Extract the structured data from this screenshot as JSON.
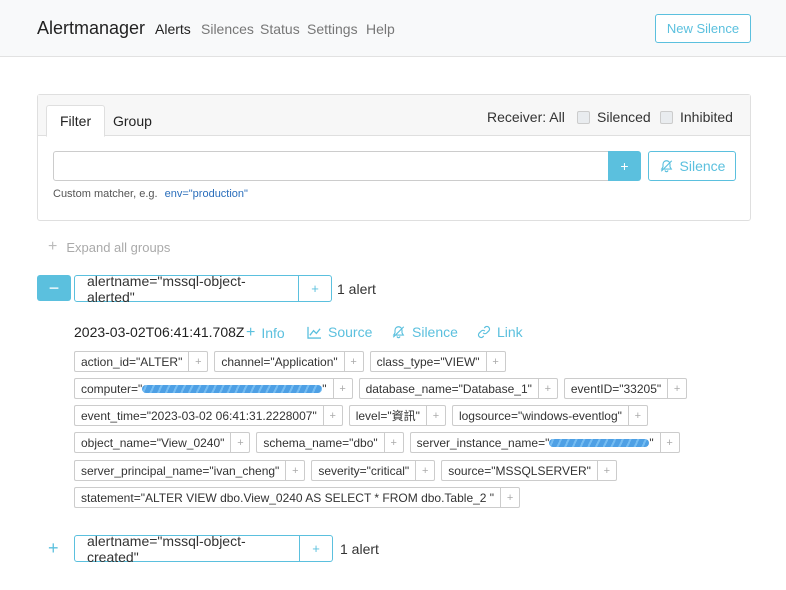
{
  "navbar": {
    "brand": "Alertmanager",
    "links": [
      "Alerts",
      "Silences",
      "Status",
      "Settings",
      "Help"
    ],
    "new_silence": "New Silence"
  },
  "filter": {
    "tabs": [
      "Filter",
      "Group"
    ],
    "receiver": "Receiver: All",
    "silenced": "Silenced",
    "inhibited": "Inhibited",
    "input_value": "",
    "plus": "+",
    "silence_btn": "Silence",
    "custom_matcher": "Custom matcher, e.g.",
    "custom_example": "env=\"production\""
  },
  "expand_all": "Expand all groups",
  "groups": [
    {
      "label": "alertname=\"mssql-object-alerted\"",
      "count": "1 alert",
      "alert": {
        "timestamp": "2023-03-02T06:41:41.708Z",
        "actions": [
          "Info",
          "Source",
          "Silence",
          "Link"
        ],
        "labels": [
          "action_id=\"ALTER\"",
          "channel=\"Application\"",
          "class_type=\"VIEW\"",
          "computer=\"",
          "database_name=\"Database_1\"",
          "eventID=\"33205\"",
          "event_time=\"2023-03-02 06:41:31.2228007\"",
          "level=\"資訊\"",
          "logsource=\"windows-eventlog\"",
          "object_name=\"View_0240\"",
          "schema_name=\"dbo\"",
          "server_instance_name=\"",
          "server_principal_name=\"ivan_cheng\"",
          "severity=\"critical\"",
          "source=\"MSSQLSERVER\"",
          "statement=\"ALTER VIEW dbo.View_0240 AS SELECT * FROM dbo.Table_2 \""
        ],
        "redacted_suffix": "\""
      }
    },
    {
      "label": "alertname=\"mssql-object-created\"",
      "count": "1 alert"
    }
  ],
  "colors": {
    "accent": "#5bc0de",
    "link": "#2a6ebb"
  }
}
